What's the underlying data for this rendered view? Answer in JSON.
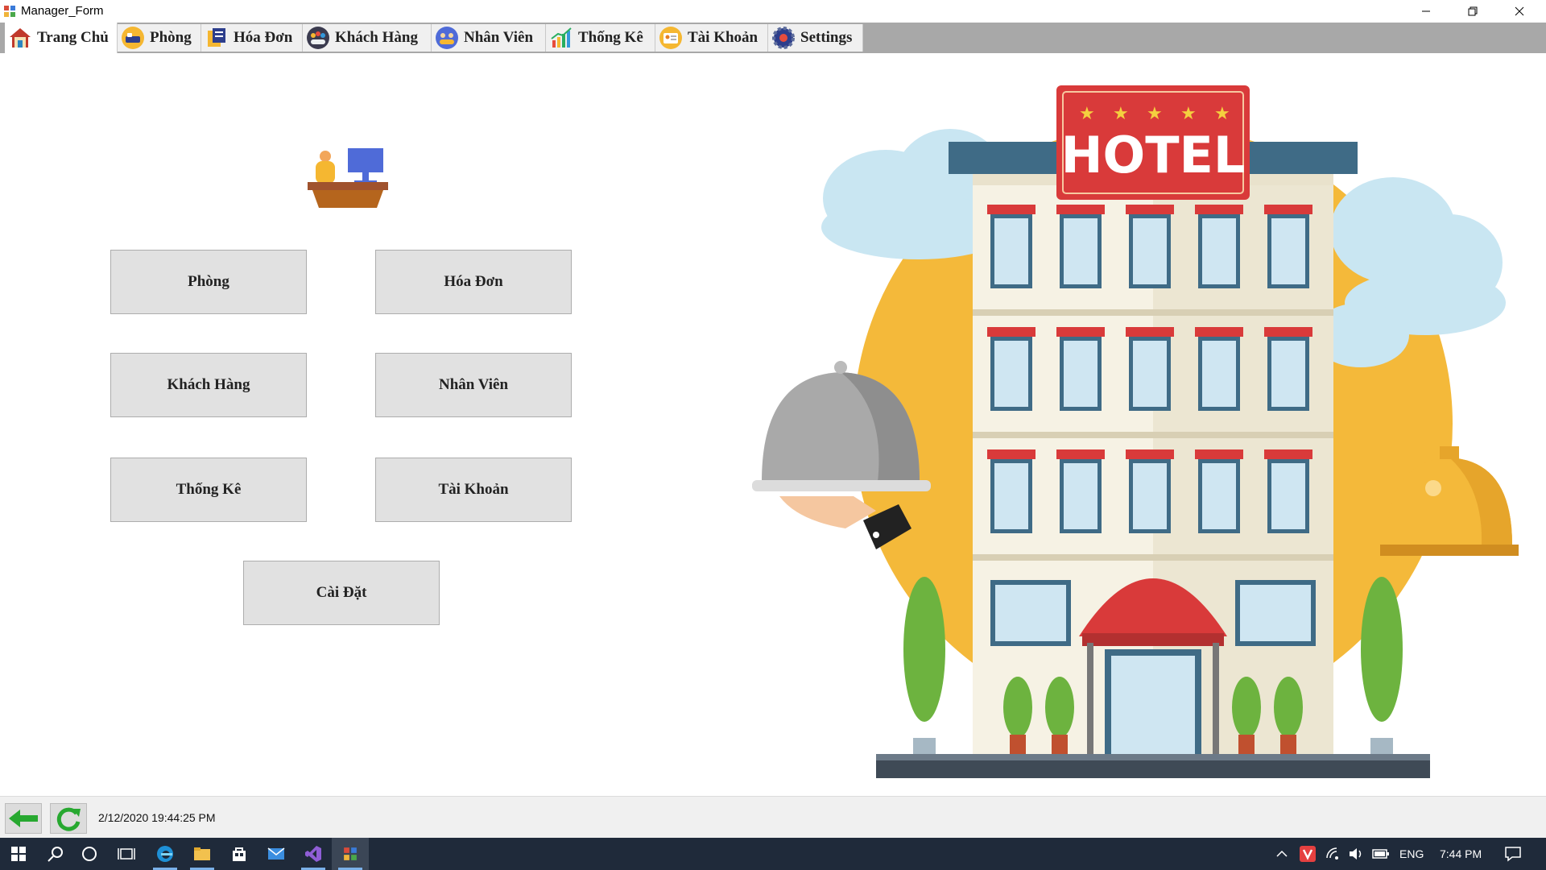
{
  "window": {
    "title": "Manager_Form",
    "controls": [
      "minimize",
      "restore",
      "close"
    ]
  },
  "tabs": [
    {
      "label": "Trang Chủ",
      "icon": "home-icon",
      "active": true
    },
    {
      "label": "Phòng",
      "icon": "room-icon"
    },
    {
      "label": "Hóa Đơn",
      "icon": "invoice-icon"
    },
    {
      "label": "Khách Hàng",
      "icon": "customers-icon"
    },
    {
      "label": "Nhân Viên",
      "icon": "staff-icon"
    },
    {
      "label": "Thống Kê",
      "icon": "chart-icon"
    },
    {
      "label": "Tài Khoản",
      "icon": "account-icon"
    },
    {
      "label": "Settings",
      "icon": "settings-gear-icon"
    }
  ],
  "main": {
    "buttons": {
      "phong": "Phòng",
      "hoadon": "Hóa Đơn",
      "khachhang": "Khách Hàng",
      "nhanvien": "Nhân Viên",
      "thongke": "Thống Kê",
      "taikhoan": "Tài Khoản",
      "caidat": "Cài Đặt"
    },
    "hotel_sign": "HOTEL"
  },
  "status": {
    "datetime": "2/12/2020 19:44:25 PM",
    "back_icon": "back-arrow-icon",
    "refresh_icon": "refresh-icon"
  },
  "taskbar": {
    "language": "ENG",
    "time": "7:44 PM"
  },
  "colors": {
    "tabbar_bg": "#a8a8a8",
    "button_bg": "#e1e1e1",
    "taskbar_bg": "#1f2a3a",
    "hotel_sun": "#f4b93a",
    "hotel_sign_red": "#d93a3a"
  }
}
